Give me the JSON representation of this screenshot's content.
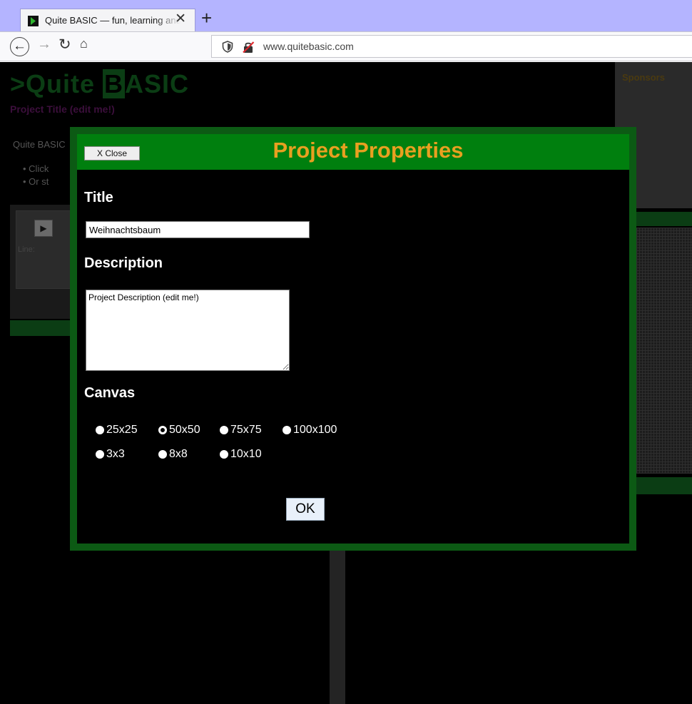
{
  "browser": {
    "tab_title": "Quite BASIC — fun, learning and programming",
    "tab_close": "✕",
    "new_tab": "+",
    "url": "www.quitebasic.com"
  },
  "page": {
    "logo_prefix": ">Quite ",
    "logo_b": "B",
    "logo_rest": "ASIC",
    "project_title": "Project Title (edit me!)",
    "sponsors_label": "Sponsors",
    "intro_text": "Quite BASIC",
    "bullets": [
      "Click",
      "Or st"
    ],
    "line_label": "Line:"
  },
  "modal": {
    "close_label": "X Close",
    "title": "Project Properties",
    "title_section": "Title",
    "title_value": "Weihnachtsbaum",
    "description_section": "Description",
    "description_value": "Project Description (edit me!)",
    "canvas_section": "Canvas",
    "canvas_options": [
      {
        "label": "25x25",
        "selected": false
      },
      {
        "label": "50x50",
        "selected": true
      },
      {
        "label": "75x75",
        "selected": false
      },
      {
        "label": "100x100",
        "selected": false
      },
      {
        "label": "3x3",
        "selected": false
      },
      {
        "label": "8x8",
        "selected": false
      },
      {
        "label": "10x10",
        "selected": false
      }
    ],
    "ok_label": "OK"
  },
  "colors": {
    "modal_border": "#0c5a14",
    "header_green": "#007f0e",
    "title_orange": "#e8a020",
    "tab_strip": "#b4b4ff"
  }
}
